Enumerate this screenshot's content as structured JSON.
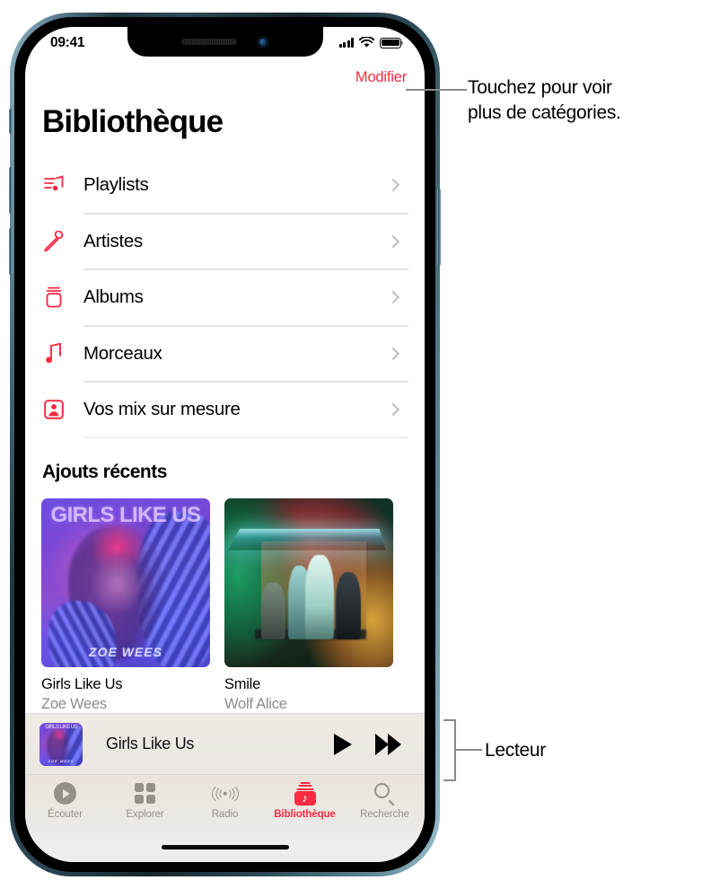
{
  "status_bar": {
    "time": "09:41",
    "signal_icon": "cellular-bars-icon",
    "wifi_icon": "wifi-icon",
    "battery_icon": "battery-icon"
  },
  "header": {
    "edit_label": "Modifier",
    "title": "Bibliothèque"
  },
  "library_rows": [
    {
      "label": "Playlists",
      "icon": "playlist-note-icon"
    },
    {
      "label": "Artistes",
      "icon": "microphone-icon"
    },
    {
      "label": "Albums",
      "icon": "album-stack-icon"
    },
    {
      "label": "Morceaux",
      "icon": "music-note-icon"
    },
    {
      "label": "Vos mix sur mesure",
      "icon": "person-card-icon"
    }
  ],
  "recent": {
    "section_title": "Ajouts récents",
    "albums": [
      {
        "title": "Girls Like Us",
        "artist": "Zoe Wees",
        "art_title": "GIRLS LIKE US",
        "art_logo": "ZOE WEES"
      },
      {
        "title": "Smile",
        "artist": "Wolf Alice"
      }
    ]
  },
  "player": {
    "now_playing": "Girls Like Us",
    "play_icon": "play-icon",
    "forward_icon": "fast-forward-icon",
    "artwork_name": "girls-like-us-artwork"
  },
  "tabs": [
    {
      "label": "Écouter",
      "icon": "listen-now-icon",
      "active": false
    },
    {
      "label": "Explorer",
      "icon": "browse-grid-icon",
      "active": false
    },
    {
      "label": "Radio",
      "icon": "radio-broadcast-icon",
      "active": false
    },
    {
      "label": "Bibliothèque",
      "icon": "library-icon",
      "active": true
    },
    {
      "label": "Recherche",
      "icon": "search-icon",
      "active": false
    }
  ],
  "callouts": {
    "top_line1": "Touchez pour voir",
    "top_line2": "plus de catégories.",
    "bottom": "Lecteur"
  },
  "colors": {
    "accent_red": "#fb2942",
    "inactive_gray": "#96908a",
    "divider": "#e2e2e4",
    "secondary_text": "#8b8b90"
  }
}
